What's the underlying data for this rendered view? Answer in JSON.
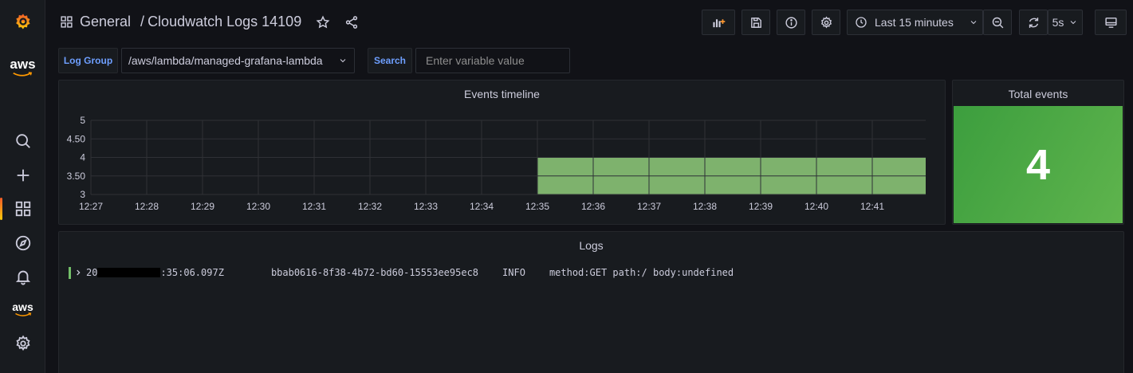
{
  "sidebar": {
    "items": [
      {
        "name": "grafana-logo-icon"
      },
      {
        "name": "aws-logo-icon",
        "label": "aws"
      },
      {
        "name": "search-icon"
      },
      {
        "name": "plus-icon"
      },
      {
        "name": "dashboards-icon"
      },
      {
        "name": "compass-icon"
      },
      {
        "name": "bell-icon"
      },
      {
        "name": "aws-icon",
        "label": "aws"
      },
      {
        "name": "gear-icon"
      }
    ]
  },
  "header": {
    "folder": "General",
    "separator": "/",
    "title": "Cloudwatch Logs 14109",
    "time_range": "Last 15 minutes",
    "refresh_interval": "5s"
  },
  "variables": {
    "log_group_label": "Log Group",
    "log_group_value": "/aws/lambda/managed-grafana-lambda",
    "search_label": "Search",
    "search_placeholder": "Enter variable value",
    "search_value": ""
  },
  "panels": {
    "timeline_title": "Events timeline",
    "total_title": "Total events",
    "total_value": "4",
    "logs_title": "Logs"
  },
  "logs": [
    {
      "ts_prefix": "20",
      "ts_suffix": ":35:06.097Z",
      "request_id": "bbab0616-8f38-4b72-bd60-15553ee95ec8",
      "level": "INFO",
      "message": "method:GET path:/ body:undefined"
    }
  ],
  "colors": {
    "accent": "#6e9fff",
    "bar_fill": "#7eb26d",
    "stat_green": "#56a64b",
    "background": "#111217",
    "panel": "#181b1f"
  },
  "chart_data": {
    "type": "bar",
    "title": "Events timeline",
    "x_ticks": [
      "12:27",
      "12:28",
      "12:29",
      "12:30",
      "12:31",
      "12:32",
      "12:33",
      "12:34",
      "12:35",
      "12:36",
      "12:37",
      "12:38",
      "12:39",
      "12:40",
      "12:41"
    ],
    "y_ticks": [
      "3",
      "3.50",
      "4",
      "4.50",
      "5"
    ],
    "ylim": [
      3,
      5
    ],
    "series": [
      {
        "x_start": "12:35",
        "x_end": "12:42",
        "value": 4
      }
    ],
    "grid": true
  }
}
